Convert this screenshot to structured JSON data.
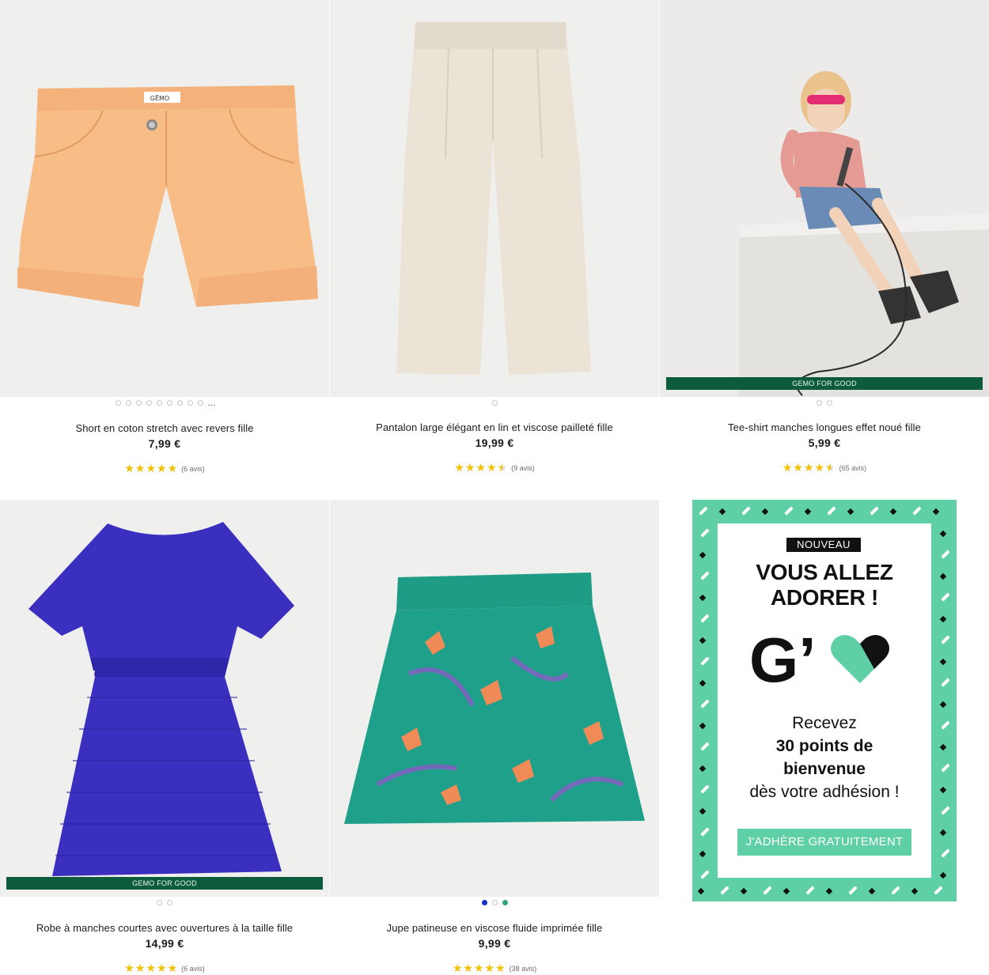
{
  "products": [
    {
      "title": "Short en coton stretch avec revers fille",
      "price": "7,99 €",
      "rating": 5,
      "reviews": "(6 avis)",
      "dots_more": "..."
    },
    {
      "title": "Pantalon large élégant en lin et viscose pailleté fille",
      "price": "19,99 €",
      "rating": 4.5,
      "reviews": "(9 avis)"
    },
    {
      "title": "Tee-shirt manches longues effet noué fille",
      "price": "5,99 €",
      "rating": 4.5,
      "reviews": "(65 avis)",
      "tag": "GEMO FOR GOOD"
    },
    {
      "title": "Robe à manches courtes avec ouvertures à la taille fille",
      "price": "14,99 €",
      "rating": 5,
      "reviews": "(6 avis)",
      "tag": "GEMO FOR GOOD"
    },
    {
      "title": "Jupe patineuse en viscose fluide imprimée fille",
      "price": "9,99 €",
      "rating": 5,
      "reviews": "(38 avis)",
      "swatch_colors": [
        "#1a2fc6",
        "#ffffff",
        "#2fa37a"
      ]
    }
  ],
  "label_text": "GĒMO",
  "promo": {
    "badge": "NOUVEAU",
    "headline_line1": "VOUS ALLEZ",
    "headline_line2": "ADORER !",
    "logo": "G’",
    "text_line1": "Recevez",
    "text_line2": "30 points de",
    "text_line3": "bienvenue",
    "text_line4": "dès votre adhésion !",
    "cta": "J'ADHÈRE GRATUITEMENT"
  },
  "colors": {
    "star": "#f2c200",
    "gfg_green": "#0c5b3c",
    "promo_mint": "#5fcfa6"
  }
}
